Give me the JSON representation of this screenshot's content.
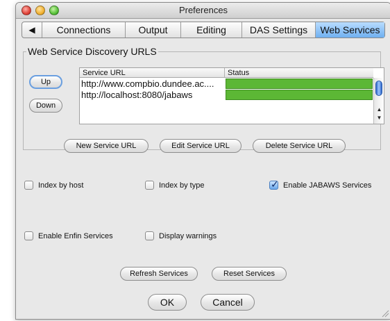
{
  "window": {
    "title": "Preferences"
  },
  "tabs": [
    {
      "label": "Connections"
    },
    {
      "label": "Output"
    },
    {
      "label": "Editing"
    },
    {
      "label": "DAS Settings"
    },
    {
      "label": "Web Services",
      "active": true
    }
  ],
  "tab_scroll_icon": "left-triangle-icon",
  "discovery": {
    "legend": "Web Service Discovery URLS",
    "up_label": "Up",
    "down_label": "Down",
    "columns": [
      "Service URL",
      "Status"
    ],
    "rows": [
      {
        "url": "http://www.compbio.dundee.ac....",
        "status_color": "#5cb735"
      },
      {
        "url": "http://localhost:8080/jabaws",
        "status_color": "#5cb735"
      }
    ],
    "new_label": "New Service URL",
    "edit_label": "Edit Service URL",
    "delete_label": "Delete Service URL"
  },
  "options": {
    "index_by_host": {
      "label": "Index by host",
      "checked": false
    },
    "index_by_type": {
      "label": "Index by type",
      "checked": false
    },
    "enable_jabaws": {
      "label": "Enable JABAWS Services",
      "checked": true
    },
    "enable_enfin": {
      "label": "Enable Enfin Services",
      "checked": false
    },
    "display_warnings": {
      "label": "Display warnings",
      "checked": false
    }
  },
  "refresh_label": "Refresh Services",
  "reset_label": "Reset Services",
  "ok_label": "OK",
  "cancel_label": "Cancel",
  "colors": {
    "active_tab": "#6fb0f0",
    "status_ok": "#5cb735",
    "scroll_thumb": "#2f66c8"
  }
}
